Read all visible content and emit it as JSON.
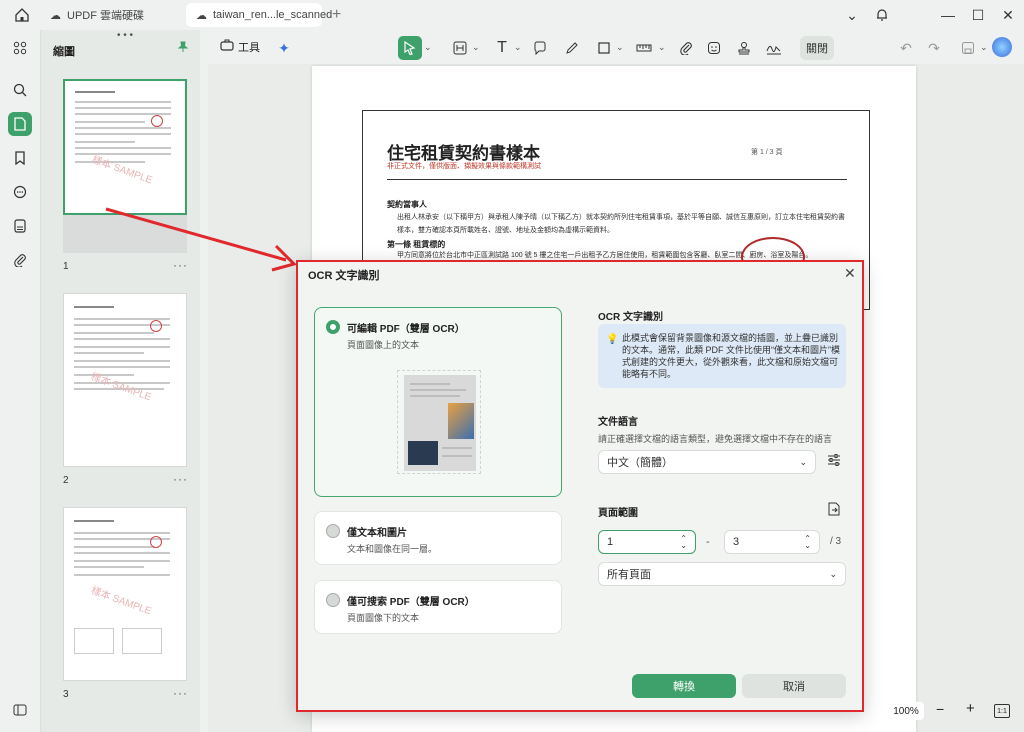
{
  "titlebar": {
    "tabs": [
      {
        "label": "UPDF 雲端硬碟",
        "icon": "cloud-icon"
      },
      {
        "label": "taiwan_ren...le_scanned",
        "icon": "document-icon"
      }
    ],
    "add_tab": "+",
    "window": {
      "dropdown": "⌄",
      "minimize": "—",
      "maximize": "☐",
      "close": "✕"
    }
  },
  "sidebar": {
    "panel_title": "縮圖",
    "pages": [
      {
        "num": "1",
        "more": "···"
      },
      {
        "num": "2",
        "more": "···"
      },
      {
        "num": "3",
        "more": "···"
      }
    ],
    "watermark": "樣本 SAMPLE"
  },
  "toolbar": {
    "tools_label": "工具",
    "close_label": "關閉"
  },
  "document": {
    "title": "住宅租賃契約書樣本",
    "subtitle": "非正式文件，僅供版面、擷擬效果與條款範構測試",
    "page_indicator": "第 1 / 3 頁",
    "section1_heading": "契約當事人",
    "section1_text": "出租人林承安（以下稱甲方）與承租人陳予晴（以下稱乙方）就本契約所列住宅租賃事項，基於平等自願、誠信互惠原則，訂立本住宅租賃契約書樣本，雙方確認本頁所載姓名、證號、地址及金額均為虛構示範資料。",
    "section2_heading": "第一條 租賃標的",
    "section2_text": "甲方同意將位於台北市中正區測試路 100 號 5 樓之住宅一戶出租予乙方居住使用，租賃範圍包含客廳、臥室二間、廚房、浴室及陽台。"
  },
  "dialog": {
    "title": "OCR 文字識別",
    "options": [
      {
        "title": "可編輯 PDF（雙層 OCR）",
        "desc": "頁面圖像上的文本",
        "selected": true
      },
      {
        "title": "僅文本和圖片",
        "desc": "文本和圖像在同一層。",
        "selected": false
      },
      {
        "title": "僅可搜索 PDF（雙層 OCR）",
        "desc": "頁面圖像下的文本",
        "selected": false
      }
    ],
    "right_title": "OCR 文字識別",
    "info_text": "此模式會保留背景圖像和源文檔的插圖，並上疊已識別的文本。通常，此類 PDF 文件比使用“僅文本和圖片”模式創建的文件更大，從外觀來看，此文檔和原始文檔可能略有不同。",
    "language_label": "文件語言",
    "language_hint": "請正確選擇文檔的語言類型，避免選擇文檔中不存在的語言",
    "language_value": "中文（簡體）",
    "range_label": "頁面範圍",
    "range_from": "1",
    "range_dash": "-",
    "range_to": "3",
    "range_total": "/ 3",
    "range_mode": "所有頁面",
    "convert_label": "轉換",
    "cancel_label": "取消"
  },
  "zoom": {
    "value": "100%",
    "minus": "−",
    "plus": "+",
    "fit": "1:1"
  },
  "colors": {
    "accent": "#3ea06a",
    "highlight": "#e0282d",
    "info_bg": "#dde9f6"
  }
}
